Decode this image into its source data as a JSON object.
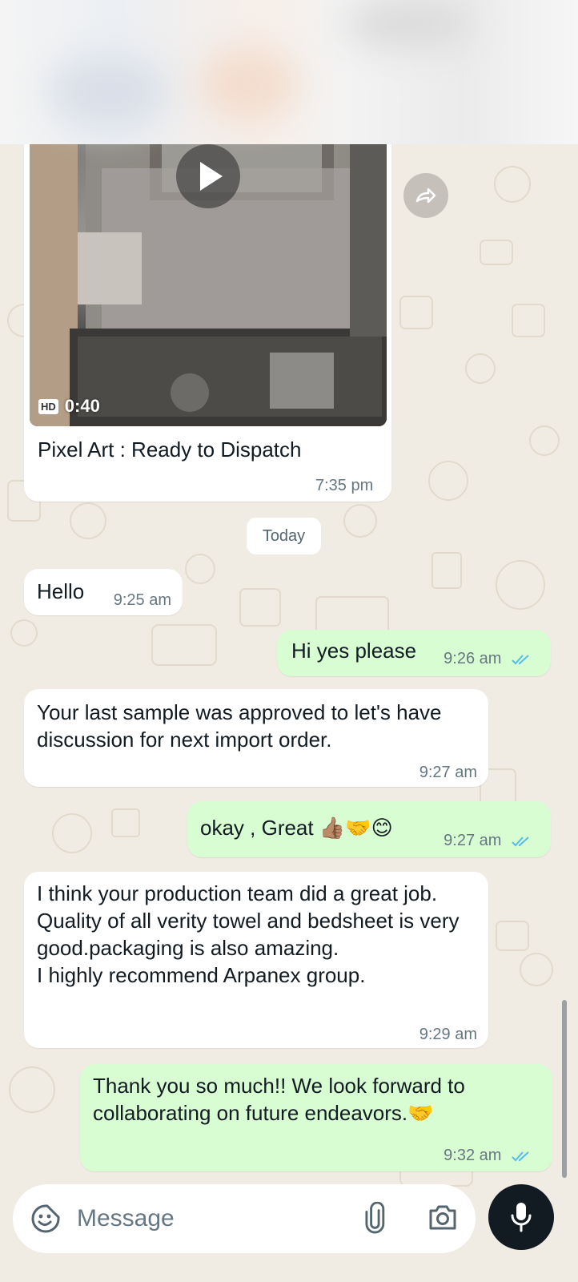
{
  "video_message": {
    "badge": "HD",
    "duration": "0:40",
    "caption": "Pixel Art : Ready to Dispatch",
    "time": "7:35 pm"
  },
  "date_separator": "Today",
  "messages": [
    {
      "direction": "in",
      "text": "Hello",
      "time": "9:25 am"
    },
    {
      "direction": "out",
      "text": "Hi yes please",
      "time": "9:26 am",
      "status": "read"
    },
    {
      "direction": "in",
      "text": "Your last sample was approved to let's have discussion for next import order.",
      "time": "9:27 am"
    },
    {
      "direction": "out",
      "text": "okay , Great 👍🏽🤝😊",
      "time": "9:27 am",
      "status": "read"
    },
    {
      "direction": "in",
      "text": "I think your production team did a great job. Quality of all verity towel and bedsheet is very good.packaging is also amazing.\nI highly recommend Arpanex group.",
      "time": "9:29 am"
    },
    {
      "direction": "out",
      "text": "Thank you so much!! We look forward to collaborating on future endeavors.🤝",
      "time": "9:32 am",
      "status": "read"
    }
  ],
  "composer": {
    "placeholder": "Message",
    "emoji_icon": "sticker-smile-icon",
    "attach_icon": "paperclip-icon",
    "camera_icon": "camera-icon",
    "mic_icon": "mic-icon"
  },
  "colors": {
    "incoming_bubble": "#ffffff",
    "outgoing_bubble": "#d9fdd3",
    "read_ticks": "#53bdeb",
    "mic_button": "#111b21",
    "wallpaper": "#f1ece3"
  }
}
